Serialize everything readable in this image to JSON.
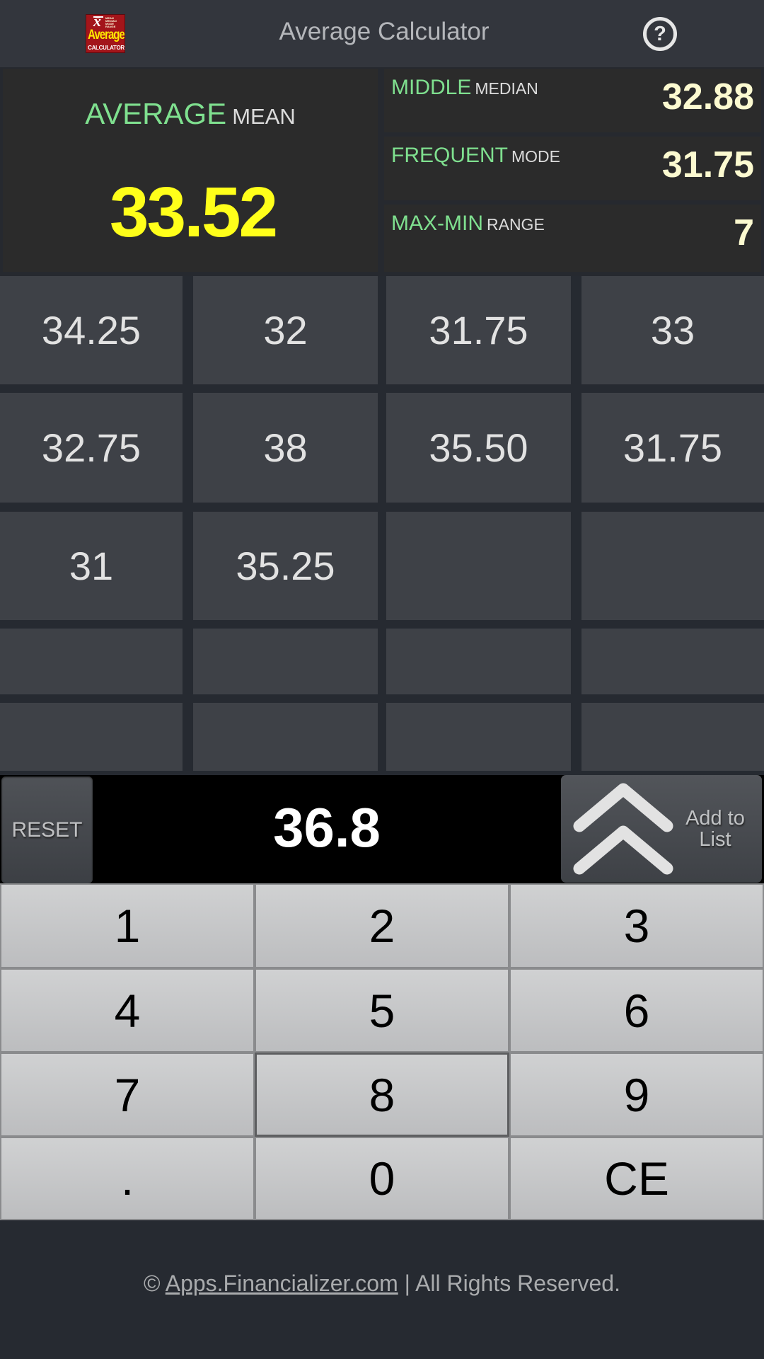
{
  "header": {
    "title": "Average Calculator",
    "logo": {
      "symbol": "x̄",
      "word": "Average",
      "subword": "CALCULATOR",
      "tiny": "MEAN MEDIAN MODE RANGE"
    },
    "help_icon": "?"
  },
  "stats": {
    "mean": {
      "label": "AVERAGE",
      "sublabel": "MEAN",
      "value": "33.52"
    },
    "median": {
      "label": "MIDDLE",
      "sublabel": "MEDIAN",
      "value": "32.88"
    },
    "mode": {
      "label": "FREQUENT",
      "sublabel": "MODE",
      "value": "31.75"
    },
    "range": {
      "label": "MAX-MIN",
      "sublabel": "RANGE",
      "value": "7"
    }
  },
  "list": {
    "values": [
      "34.25",
      "32",
      "31.75",
      "33",
      "32.75",
      "38",
      "35.50",
      "31.75",
      "31",
      "35.25",
      "",
      "",
      "",
      "",
      "",
      "",
      "",
      "",
      "",
      ""
    ]
  },
  "entry": {
    "reset_label": "RESET",
    "value": "36.8",
    "add_label_line1": "Add to",
    "add_label_line2": "List"
  },
  "keypad": {
    "keys": [
      "1",
      "2",
      "3",
      "4",
      "5",
      "6",
      "7",
      "8",
      "9",
      ".",
      "0",
      "CE"
    ],
    "pressed_key": "8"
  },
  "footer": {
    "copyright": "©",
    "link_text": "Apps.Financializer.com",
    "suffix": "| All Rights Reserved."
  },
  "colors": {
    "label_green": "#7fe08f",
    "mean_yellow": "#ffff1a",
    "stat_value": "#fcfad0",
    "header_bg": "#33363d",
    "cell_bg": "#3e4147"
  }
}
